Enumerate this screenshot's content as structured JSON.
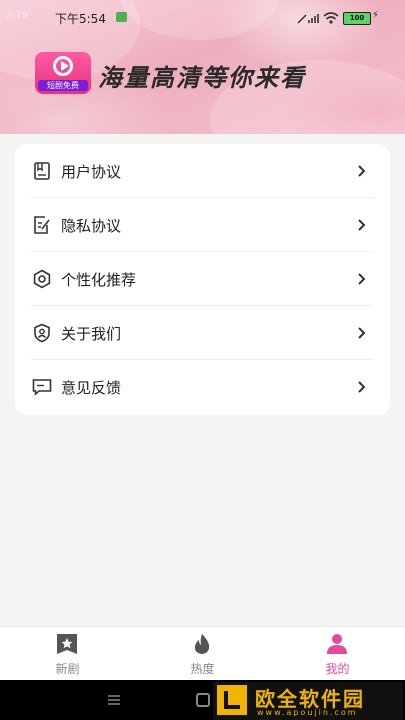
{
  "status": {
    "left_text": "2:19",
    "time": "下午5:54",
    "battery": "100",
    "charge_glyph": "⚡"
  },
  "banner": {
    "logo_tag": "短剧免费",
    "slogan": "海量高清等你来看"
  },
  "menu": {
    "items": [
      {
        "label": "用户协议",
        "icon": "document-icon"
      },
      {
        "label": "隐私协议",
        "icon": "edit-document-icon"
      },
      {
        "label": "个性化推荐",
        "icon": "gear-icon"
      },
      {
        "label": "关于我们",
        "icon": "shield-user-icon"
      },
      {
        "label": "意见反馈",
        "icon": "chat-icon"
      }
    ]
  },
  "tabs": [
    {
      "label": "新剧",
      "icon": "star-box-icon",
      "active": false
    },
    {
      "label": "热度",
      "icon": "flame-icon",
      "active": false
    },
    {
      "label": "我的",
      "icon": "person-icon",
      "active": true
    }
  ],
  "colors": {
    "accent": "#e24a9b",
    "banner": "#eeaebd",
    "background": "#f4f4f4"
  },
  "watermark": {
    "title": "欧全软件园",
    "url": "www.apoujin.com"
  }
}
